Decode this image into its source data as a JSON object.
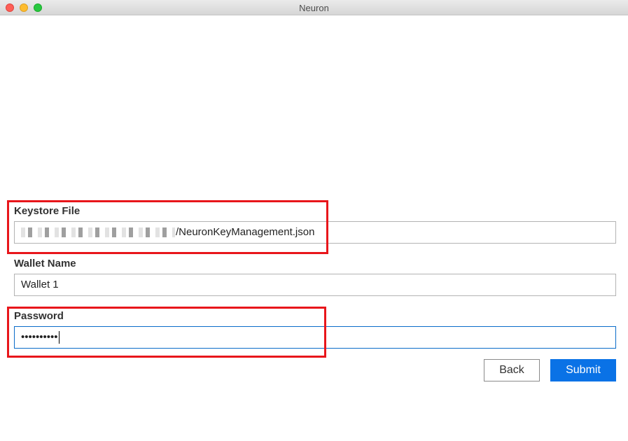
{
  "window": {
    "title": "Neuron"
  },
  "form": {
    "keystore": {
      "label": "Keystore File",
      "value_suffix": "/NeuronKeyManagement.json"
    },
    "wallet_name": {
      "label": "Wallet Name",
      "value": "Wallet 1"
    },
    "password": {
      "label": "Password",
      "masked_value": "••••••••••"
    }
  },
  "buttons": {
    "back_label": "Back",
    "submit_label": "Submit"
  },
  "colors": {
    "accent": "#0a72e6",
    "highlight": "#e8161b",
    "focus_border": "#0a6cc9"
  }
}
